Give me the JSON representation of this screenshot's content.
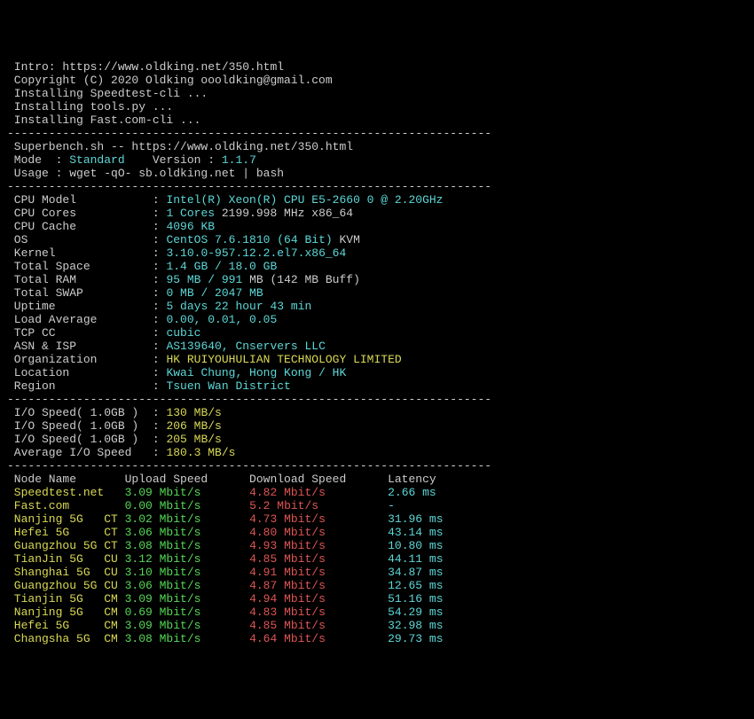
{
  "intro": {
    "intro_label": " Intro: ",
    "intro_url": "https://www.oldking.net/350.html",
    "copyright": " Copyright (C) 2020 Oldking oooldking@gmail.com",
    "install1": " Installing Speedtest-cli ...",
    "install2": " Installing tools.py ...",
    "install3": " Installing Fast.com-cli ..."
  },
  "sep": "----------------------------------------------------------------------",
  "header": {
    "title": " Superbench.sh -- https://www.oldking.net/350.html",
    "mode_label": " Mode  : ",
    "mode_value": "Standard",
    "version_label": "    Version : ",
    "version_value": "1.1.7",
    "usage": " Usage : wget -qO- sb.oldking.net | bash"
  },
  "sys": {
    "cpu_model": {
      "label": " CPU Model          ",
      "colon": " : ",
      "value": "Intel(R) Xeon(R) CPU E5-2660 0 @ 2.20GHz"
    },
    "cpu_cores": {
      "label": " CPU Cores          ",
      "colon": " : ",
      "value1": "1 Cores",
      "value2": " 2199.998 MHz x86_64"
    },
    "cpu_cache": {
      "label": " CPU Cache          ",
      "colon": " : ",
      "value": "4096 KB"
    },
    "os": {
      "label": " OS                 ",
      "colon": " : ",
      "value1": "CentOS 7.6.1810 (64 Bit)",
      "value2": " KVM"
    },
    "kernel": {
      "label": " Kernel             ",
      "colon": " : ",
      "value": "3.10.0-957.12.2.el7.x86_64"
    },
    "total_space": {
      "label": " Total Space        ",
      "colon": " : ",
      "value": "1.4 GB / 18.0 GB"
    },
    "total_ram": {
      "label": " Total RAM          ",
      "colon": " : ",
      "value1": "95 MB / 991",
      "value2": " MB (142 MB Buff)"
    },
    "total_swap": {
      "label": " Total SWAP         ",
      "colon": " : ",
      "value": "0 MB / 2047 MB"
    },
    "uptime": {
      "label": " Uptime             ",
      "colon": " : ",
      "value": "5 days 22 hour 43 min"
    },
    "load": {
      "label": " Load Average       ",
      "colon": " : ",
      "value": "0.00, 0.01, 0.05"
    },
    "tcp": {
      "label": " TCP CC             ",
      "colon": " : ",
      "value": "cubic"
    },
    "asn": {
      "label": " ASN & ISP          ",
      "colon": " : ",
      "value": "AS139640, Cnservers LLC"
    },
    "org": {
      "label": " Organization       ",
      "colon": " : ",
      "value": "HK RUIYOUHULIAN TECHNOLOGY LIMITED"
    },
    "loc": {
      "label": " Location           ",
      "colon": " : ",
      "value": "Kwai Chung, Hong Kong / HK"
    },
    "region": {
      "label": " Region             ",
      "colon": " : ",
      "value": "Tsuen Wan District"
    }
  },
  "io": {
    "r1": {
      "label": " I/O Speed( 1.0GB )",
      "colon": "  : ",
      "value": "130 MB/s"
    },
    "r2": {
      "label": " I/O Speed( 1.0GB )",
      "colon": "  : ",
      "value": "206 MB/s"
    },
    "r3": {
      "label": " I/O Speed( 1.0GB )",
      "colon": "  : ",
      "value": "205 MB/s"
    },
    "avg": {
      "label": " Average I/O Speed ",
      "colon": "  : ",
      "value": "180.3 MB/s"
    }
  },
  "net": {
    "head": " Node Name       Upload Speed      Download Speed      Latency",
    "rows": [
      {
        "name": " Speedtest.net  ",
        "up": "3.09 Mbit/s       ",
        "down": "4.82 Mbit/s         ",
        "lat": "2.66 ms"
      },
      {
        "name": " Fast.com       ",
        "up": "0.00 Mbit/s       ",
        "down": "5.2 Mbit/s          ",
        "lat": "-"
      },
      {
        "name": " Nanjing 5G   CT",
        "up": "3.02 Mbit/s       ",
        "down": "4.73 Mbit/s         ",
        "lat": "31.96 ms"
      },
      {
        "name": " Hefei 5G     CT",
        "up": "3.06 Mbit/s       ",
        "down": "4.80 Mbit/s         ",
        "lat": "43.14 ms"
      },
      {
        "name": " Guangzhou 5G CT",
        "up": "3.08 Mbit/s       ",
        "down": "4.93 Mbit/s         ",
        "lat": "10.80 ms"
      },
      {
        "name": " TianJin 5G   CU",
        "up": "3.12 Mbit/s       ",
        "down": "4.85 Mbit/s         ",
        "lat": "44.11 ms"
      },
      {
        "name": " Shanghai 5G  CU",
        "up": "3.10 Mbit/s       ",
        "down": "4.91 Mbit/s         ",
        "lat": "34.87 ms"
      },
      {
        "name": " Guangzhou 5G CU",
        "up": "3.06 Mbit/s       ",
        "down": "4.87 Mbit/s         ",
        "lat": "12.65 ms"
      },
      {
        "name": " Tianjin 5G   CM",
        "up": "3.09 Mbit/s       ",
        "down": "4.94 Mbit/s         ",
        "lat": "51.16 ms"
      },
      {
        "name": " Nanjing 5G   CM",
        "up": "0.69 Mbit/s       ",
        "down": "4.83 Mbit/s         ",
        "lat": "54.29 ms"
      },
      {
        "name": " Hefei 5G     CM",
        "up": "3.09 Mbit/s       ",
        "down": "4.85 Mbit/s         ",
        "lat": "32.98 ms"
      },
      {
        "name": " Changsha 5G  CM",
        "up": "3.08 Mbit/s       ",
        "down": "4.64 Mbit/s         ",
        "lat": "29.73 ms"
      }
    ]
  }
}
